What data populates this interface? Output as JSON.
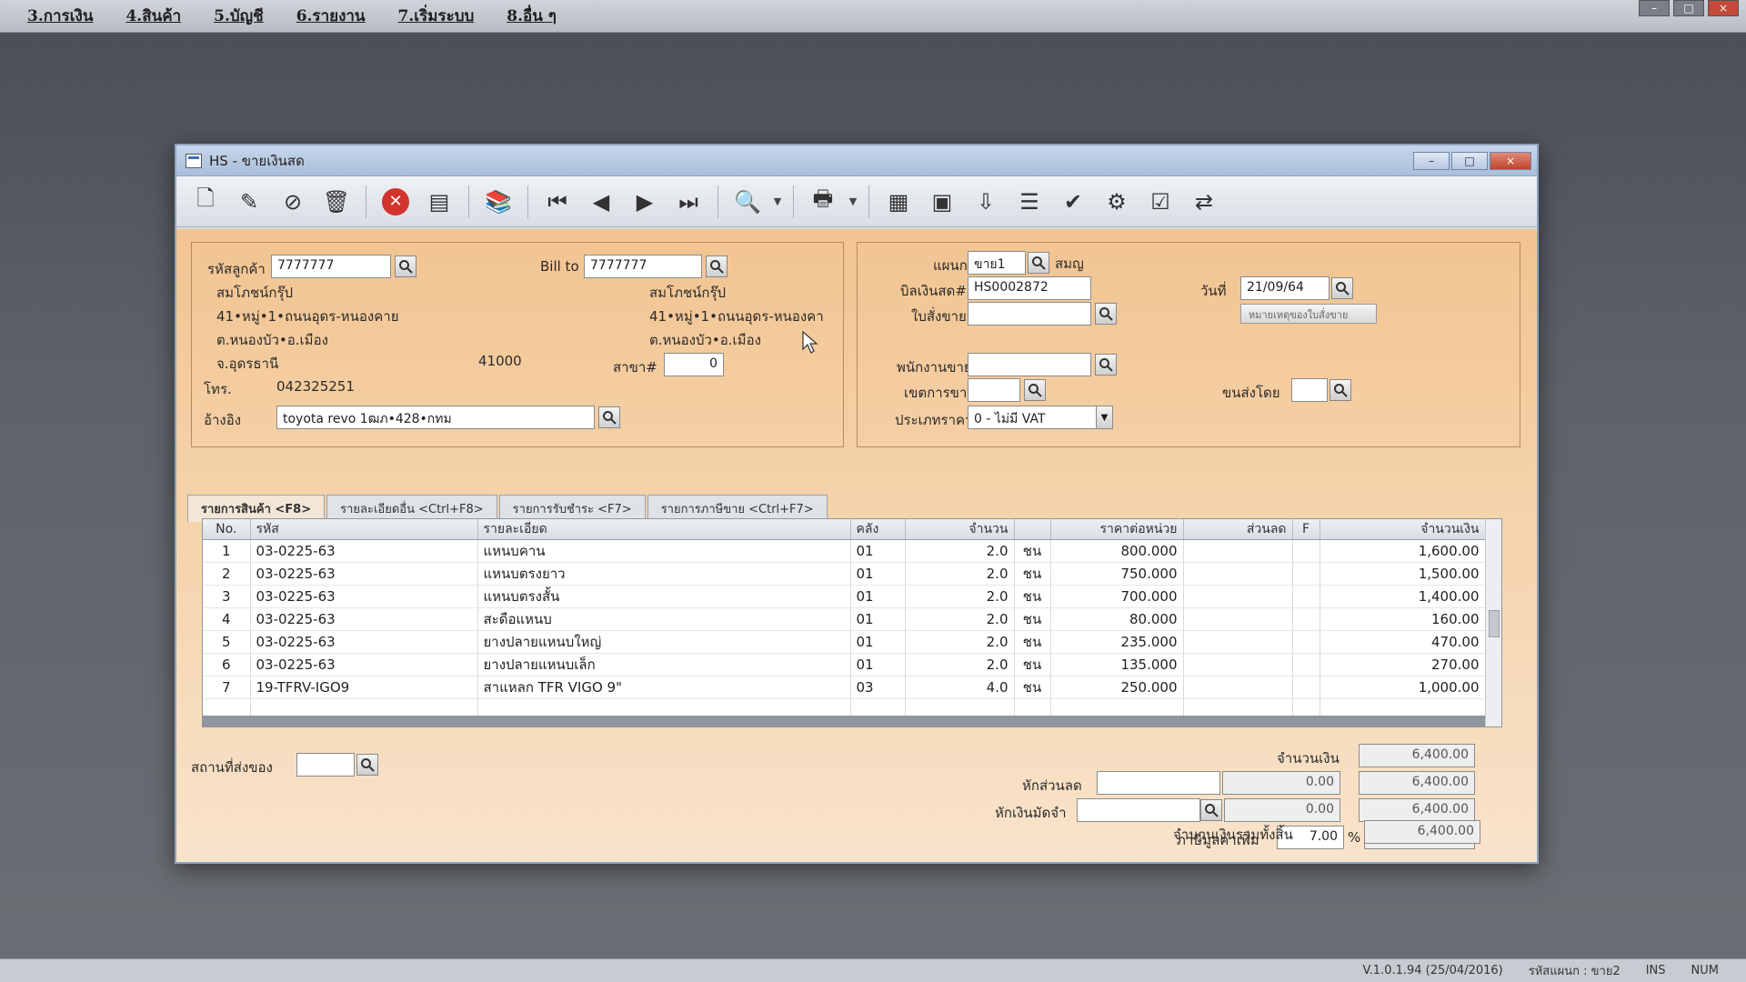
{
  "menubar": {
    "items": [
      "3.การเงิน",
      "4.สินค้า",
      "5.บัญชี",
      "6.รายงาน",
      "7.เริ่มระบบ",
      "8.อื่น ๆ"
    ]
  },
  "window": {
    "title": "HS - ขายเงินสด"
  },
  "toolbar": {
    "tools": [
      "new-document-icon",
      "edit-icon",
      "void-icon",
      "delete-bin-icon",
      "stop-icon",
      "save-icon",
      "books-icon",
      "first-record-icon",
      "previous-record-icon",
      "next-record-icon",
      "last-record-icon",
      "find-icon",
      "print-icon",
      "report-icon",
      "calculator-icon",
      "import-icon",
      "document-list-icon",
      "approve-icon",
      "tools-icon",
      "ok-icon",
      "network-icon"
    ]
  },
  "customer": {
    "code_label": "รหัสลูกค้า",
    "code_value": "7777777",
    "name": "สมโภชน์กรุ๊ป",
    "address1": "41•หมู่•1•ถนนอุดร-หนองคาย",
    "address2": "ต.หนองบัว•อ.เมือง",
    "province": "จ.อุดรธานี",
    "zip": "41000",
    "phone_label": "โทร.",
    "phone": "042325251",
    "ref_label": "อ้างอิง",
    "ref_value": "toyota revo 1ฒภ•428•กทม"
  },
  "bill_to": {
    "label": "Bill to",
    "value": "7777777",
    "name": "สมโภชน์กรุ๊ป",
    "address1": "41•หมู่•1•ถนนอุดร-หนองคา",
    "address2": "ต.หนองบัว•อ.เมือง",
    "branch_label": "สาขา#",
    "branch_value": "0"
  },
  "doc": {
    "dept_label": "แผนก",
    "dept_value": "ขาย1",
    "dept_name": "สมญ",
    "bill_label": "บิลเงินสด#",
    "bill_value": "HS0002872",
    "date_label": "วันที่",
    "date_value": "21/09/64",
    "order_label": "ใบสั่งขาย",
    "order_value": "",
    "note_button": "หมายเหตุของใบสั่งขาย",
    "sales_label": "พนักงานขาย",
    "sales_value": "",
    "area_label": "เขตการขาย",
    "area_value": "",
    "ship_label": "ขนส่งโดย",
    "ship_value": "",
    "price_type_label": "ประเภทราคา",
    "price_type_value": "0 - ไม่มี VAT"
  },
  "tabs": [
    "รายการสินค้า <F8>",
    "รายละเอียดอื่น <Ctrl+F8>",
    "รายการรับชำระ <F7>",
    "รายการภาษีขาย <Ctrl+F7>"
  ],
  "grid": {
    "headers": [
      "No.",
      "รหัส",
      "รายละเอียด",
      "คลัง",
      "จำนวน",
      "",
      "ราคาต่อหน่วย",
      "ส่วนลด",
      "F",
      "จำนวนเงิน"
    ],
    "rows": [
      {
        "no": "1",
        "code": "03-0225-63",
        "desc": "แหนบคาน",
        "wh": "01",
        "qty": "2.0",
        "unit": "ชน",
        "price": "800.000",
        "disc": "",
        "f": "",
        "amount": "1,600.00"
      },
      {
        "no": "2",
        "code": "03-0225-63",
        "desc": "แหนบตรงยาว",
        "wh": "01",
        "qty": "2.0",
        "unit": "ชน",
        "price": "750.000",
        "disc": "",
        "f": "",
        "amount": "1,500.00"
      },
      {
        "no": "3",
        "code": "03-0225-63",
        "desc": "แหนบตรงสั้น",
        "wh": "01",
        "qty": "2.0",
        "unit": "ชน",
        "price": "700.000",
        "disc": "",
        "f": "",
        "amount": "1,400.00"
      },
      {
        "no": "4",
        "code": "03-0225-63",
        "desc": "สะดือแหนบ",
        "wh": "01",
        "qty": "2.0",
        "unit": "ชน",
        "price": "80.000",
        "disc": "",
        "f": "",
        "amount": "160.00"
      },
      {
        "no": "5",
        "code": "03-0225-63",
        "desc": "ยางปลายแหนบใหญ่",
        "wh": "01",
        "qty": "2.0",
        "unit": "ชน",
        "price": "235.000",
        "disc": "",
        "f": "",
        "amount": "470.00"
      },
      {
        "no": "6",
        "code": "03-0225-63",
        "desc": "ยางปลายแหนบเล็ก",
        "wh": "01",
        "qty": "2.0",
        "unit": "ชน",
        "price": "135.000",
        "disc": "",
        "f": "",
        "amount": "270.00"
      },
      {
        "no": "7",
        "code": "19-TFRV-IGO9",
        "desc": "สาแหลก TFR VIGO 9\"",
        "wh": "03",
        "qty": "4.0",
        "unit": "ชน",
        "price": "250.000",
        "disc": "",
        "f": "",
        "amount": "1,000.00"
      }
    ]
  },
  "footer": {
    "ship_place_label": "สถานที่ส่งของ",
    "ship_place_value": "",
    "amount_label": "จำนวนเงิน",
    "amount_value": "6,400.00",
    "discount_label": "หักส่วนลด",
    "discount_input": "",
    "discount_value": "0.00",
    "discount_total": "6,400.00",
    "deposit_label": "หักเงินมัดจำ",
    "deposit_input": "",
    "deposit_value": "0.00",
    "deposit_total": "6,400.00",
    "vat_label": "ภาษีมูลค่าเพิ่ม",
    "vat_rate": "7.00",
    "vat_pct": "%",
    "vat_value": "0.00",
    "grand_label": "จำนวนเงินรวมทั้งสิ้น",
    "grand_value": "6,400.00"
  },
  "statusbar": {
    "version": "V.1.0.1.94 (25/04/2016)",
    "user": "รหัสแผนก : ขาย2",
    "ins": "INS",
    "num": "NUM"
  }
}
